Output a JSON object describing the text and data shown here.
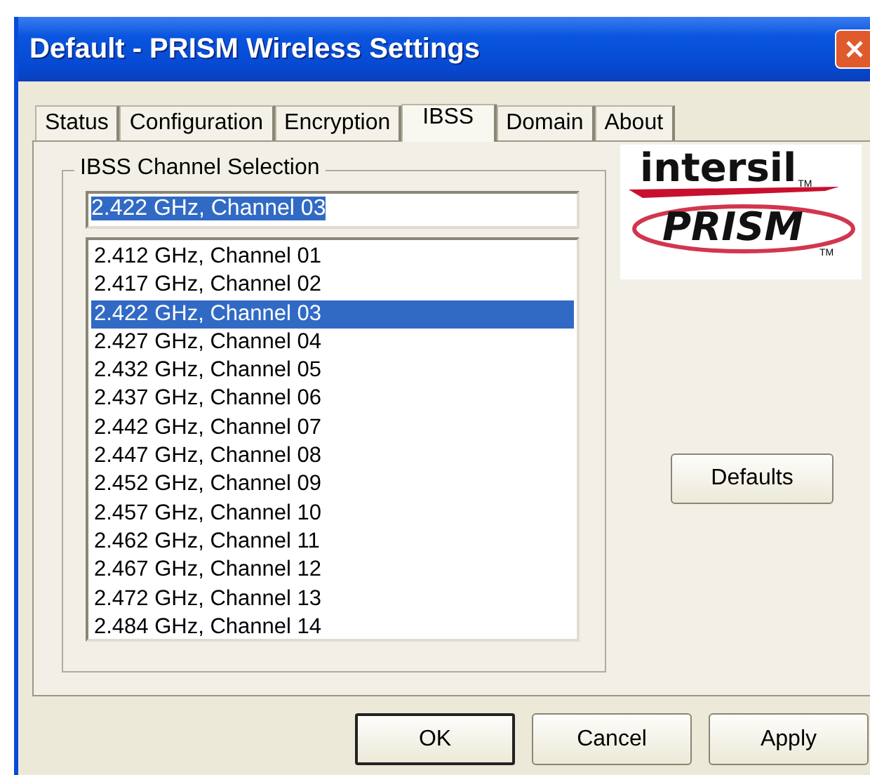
{
  "window": {
    "title": "Default - PRISM Wireless Settings"
  },
  "tabs": [
    {
      "label": "Status",
      "selected": false
    },
    {
      "label": "Configuration",
      "selected": false
    },
    {
      "label": "Encryption",
      "selected": false
    },
    {
      "label": "IBSS",
      "selected": true
    },
    {
      "label": "Domain",
      "selected": false
    },
    {
      "label": "About",
      "selected": false
    }
  ],
  "group": {
    "title": "IBSS Channel Selection",
    "field": {
      "value": "2.422 GHz, Channel 03"
    },
    "channels": [
      {
        "label": "2.412 GHz, Channel 01",
        "selected": false
      },
      {
        "label": "2.417 GHz, Channel 02",
        "selected": false
      },
      {
        "label": "2.422 GHz, Channel 03",
        "selected": true
      },
      {
        "label": "2.427 GHz, Channel 04",
        "selected": false
      },
      {
        "label": "2.432 GHz, Channel 05",
        "selected": false
      },
      {
        "label": "2.437 GHz, Channel 06",
        "selected": false
      },
      {
        "label": "2.442 GHz, Channel 07",
        "selected": false
      },
      {
        "label": "2.447 GHz, Channel 08",
        "selected": false
      },
      {
        "label": "2.452 GHz, Channel 09",
        "selected": false
      },
      {
        "label": "2.457 GHz, Channel 10",
        "selected": false
      },
      {
        "label": "2.462 GHz, Channel 11",
        "selected": false
      },
      {
        "label": "2.467 GHz, Channel 12",
        "selected": false
      },
      {
        "label": "2.472 GHz, Channel 13",
        "selected": false
      },
      {
        "label": "2.484 GHz, Channel 14",
        "selected": false
      }
    ]
  },
  "logo": {
    "brand": "intersil",
    "brand_mark": "TM",
    "product": "PRISM",
    "product_mark": "TM"
  },
  "defaults_button": "Defaults",
  "buttons": [
    "OK",
    "Cancel",
    "Apply"
  ]
}
